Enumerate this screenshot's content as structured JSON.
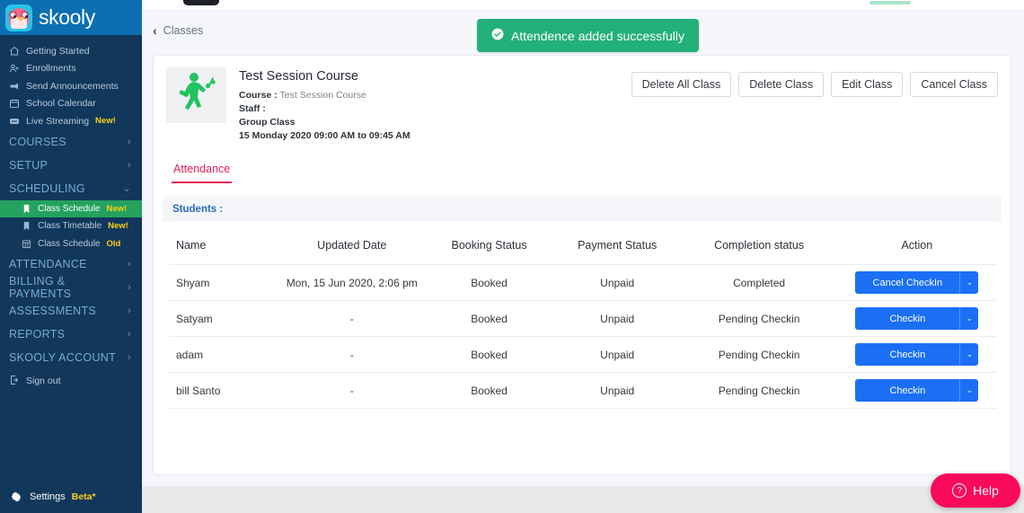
{
  "brand": {
    "name": "skooly",
    "logo_icon": "owl-icon",
    "logo_bg": "#27c4e8",
    "sidebar_bg": "#11375b",
    "active_bg": "#24a25e"
  },
  "sidebar": {
    "items": [
      {
        "label": "Getting Started",
        "icon": "home-icon"
      },
      {
        "label": "Enrollments",
        "icon": "user-add-icon"
      },
      {
        "label": "Send Announcements",
        "icon": "megaphone-icon"
      },
      {
        "label": "School Calendar",
        "icon": "calendar-icon"
      },
      {
        "label": "Live Streaming",
        "icon": "video-icon",
        "badge": "New!"
      }
    ],
    "sections": [
      {
        "label": "COURSES",
        "chevron": "›",
        "expanded": false
      },
      {
        "label": "SETUP",
        "chevron": "›",
        "expanded": false
      },
      {
        "label": "SCHEDULING",
        "chevron": "⌄",
        "expanded": true
      }
    ],
    "scheduling_children": [
      {
        "label": "Class Schedule",
        "icon": "bookmark-icon",
        "badge": "New!",
        "active": true
      },
      {
        "label": "Class Timetable",
        "icon": "bookmark-icon",
        "badge": "New!",
        "active": false
      },
      {
        "label": "Class Schedule",
        "icon": "grid-icon",
        "badge": "Old",
        "active": false
      }
    ],
    "sections_after": [
      {
        "label": "ATTENDANCE",
        "chevron": "›"
      },
      {
        "label": "BILLING & PAYMENTS",
        "chevron": "›"
      },
      {
        "label": "ASSESSMENTS",
        "chevron": "›"
      },
      {
        "label": "REPORTS",
        "chevron": "›"
      },
      {
        "label": "SKOOLY ACCOUNT",
        "chevron": "›"
      }
    ],
    "sign_out": {
      "label": "Sign out",
      "icon": "sign-out-icon"
    },
    "settings": {
      "label": "Settings",
      "badge": "Beta*",
      "icon": "gear-icon"
    }
  },
  "breadcrumb": {
    "label": "Classes",
    "back_icon": "chevron-left-icon"
  },
  "toast": {
    "message": "Attendence added successfully",
    "icon": "check-circle-icon",
    "color": "#23b07a"
  },
  "course": {
    "thumb_icon": "dancing-person-icon",
    "title": "Test Session Course",
    "course_label": "Course :",
    "course_value": "Test Session Course",
    "staff_label": "Staff :",
    "staff_value": "",
    "class_type": "Group Class",
    "schedule": "15 Monday 2020 09:00 AM to 09:45 AM",
    "buttons": [
      {
        "label": "Delete All Class",
        "name": "delete-all-class-button"
      },
      {
        "label": "Delete Class",
        "name": "delete-class-button"
      },
      {
        "label": "Edit Class",
        "name": "edit-class-button"
      },
      {
        "label": "Cancel Class",
        "name": "cancel-class-button"
      }
    ]
  },
  "tabs": [
    {
      "label": "Attendance",
      "active": true
    }
  ],
  "students_section": {
    "label": "Students :"
  },
  "table": {
    "headers": [
      "Name",
      "Updated Date",
      "Booking Status",
      "Payment Status",
      "Completion status",
      "Action"
    ],
    "rows": [
      {
        "name": "Shyam",
        "updated_date": "Mon, 15 Jun 2020, 2:06 pm",
        "booking_status": "Booked",
        "payment_status": "Unpaid",
        "completion_status": "Completed",
        "action_label": "Cancel CheckIn",
        "action_caret": "⌄"
      },
      {
        "name": "Satyam",
        "updated_date": "-",
        "booking_status": "Booked",
        "payment_status": "Unpaid",
        "completion_status": "Pending Checkin",
        "action_label": "Checkin",
        "action_caret": "⌄"
      },
      {
        "name": "adam",
        "updated_date": "-",
        "booking_status": "Booked",
        "payment_status": "Unpaid",
        "completion_status": "Pending Checkin",
        "action_label": "Checkin",
        "action_caret": "⌄"
      },
      {
        "name": "bill Santo",
        "updated_date": "-",
        "booking_status": "Booked",
        "payment_status": "Unpaid",
        "completion_status": "Pending Checkin",
        "action_label": "Checkin",
        "action_caret": "⌄"
      }
    ],
    "action_button_color": "#1b6ff5"
  },
  "help_widget": {
    "label": "Help",
    "icon": "question-mark-icon",
    "color": "#fa0a5a"
  }
}
